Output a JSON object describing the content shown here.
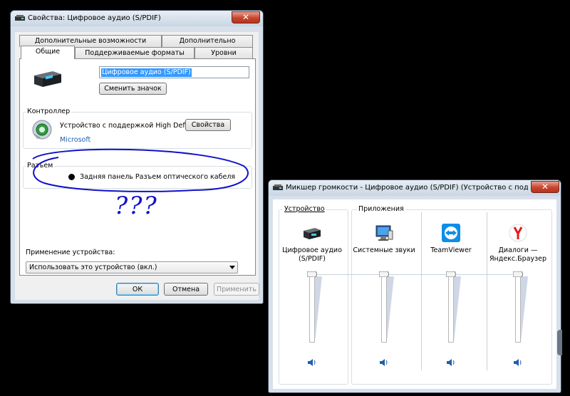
{
  "props": {
    "title": "Свойства: Цифровое аудио (S/PDIF)",
    "tabs_row1": [
      "Дополнительные возможности",
      "Дополнительно"
    ],
    "tabs_row2": [
      "Общие",
      "Поддерживаемые форматы",
      "Уровни"
    ],
    "device_name": "Цифровое аудио (S/PDIF)",
    "change_icon": "Сменить значок",
    "controller": {
      "label": "Контроллер",
      "name": "Устройство с поддержкой High Defi...",
      "vendor": "Microsoft",
      "properties": "Свойства"
    },
    "jack": {
      "label": "Разъем",
      "item": "Задняя панель Разъем оптического кабеля"
    },
    "annotation": "???",
    "usage": {
      "label": "Применение устройства:",
      "value": "Использовать это устройство (вкл.)"
    },
    "buttons": {
      "ok": "ОК",
      "cancel": "Отмена",
      "apply": "Применить"
    }
  },
  "mixer": {
    "title": "Микшер громкости - Цифровое аудио (S/PDIF) (Устройство с поддерж...",
    "device_header": "Устройство",
    "apps_header": "Приложения",
    "channels": [
      {
        "label": "Цифровое аудио (S/PDIF)",
        "icon": "speaker-device-icon",
        "level": 1.0
      },
      {
        "label": "Системные звуки",
        "icon": "system-sounds-icon",
        "level": 1.0
      },
      {
        "label": "TeamViewer",
        "icon": "teamviewer-icon",
        "level": 1.0
      },
      {
        "label": "Диалоги — Яндекс.Браузер",
        "icon": "yandex-browser-icon",
        "level": 1.0
      }
    ]
  },
  "colors": {
    "title_bg": "#c9d6e3",
    "close": "#c9442e",
    "link": "#1f5fae",
    "ink": "#1010c8"
  }
}
